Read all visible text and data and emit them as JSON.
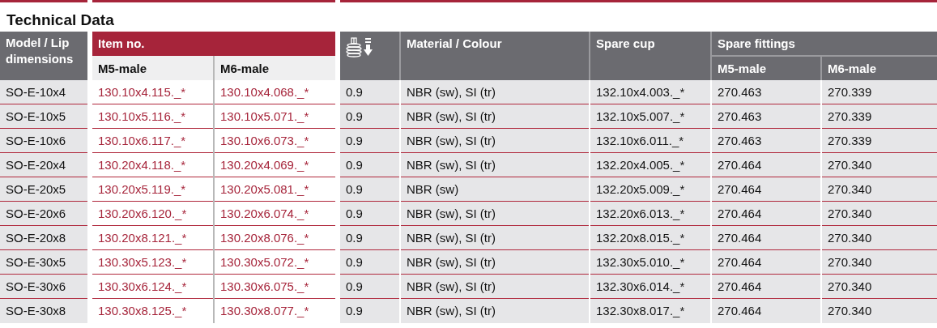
{
  "title": "Technical Data",
  "headers": {
    "model": "Model / Lip dimensions",
    "item_no": "Item no.",
    "item_m5": "M5-male",
    "item_m6": "M6-male",
    "material": "Material / Colour",
    "spare_cup": "Spare cup",
    "spare_fittings": "Spare fittings",
    "fit_m5": "M5-male",
    "fit_m6": "M6-male"
  },
  "rows": [
    {
      "model": "SO-E-10x4",
      "item_m5": "130.10x4.115._*",
      "item_m6": "130.10x4.068._*",
      "stroke": "0.9",
      "material": "NBR (sw), SI (tr)",
      "spare_cup": "132.10x4.003._*",
      "fit_m5": "270.463",
      "fit_m6": "270.339"
    },
    {
      "model": "SO-E-10x5",
      "item_m5": "130.10x5.116._*",
      "item_m6": "130.10x5.071._*",
      "stroke": "0.9",
      "material": "NBR (sw), SI (tr)",
      "spare_cup": "132.10x5.007._*",
      "fit_m5": "270.463",
      "fit_m6": "270.339"
    },
    {
      "model": "SO-E-10x6",
      "item_m5": "130.10x6.117._*",
      "item_m6": "130.10x6.073._*",
      "stroke": "0.9",
      "material": "NBR (sw), SI (tr)",
      "spare_cup": "132.10x6.011._*",
      "fit_m5": "270.463",
      "fit_m6": "270.339"
    },
    {
      "model": "SO-E-20x4",
      "item_m5": "130.20x4.118._*",
      "item_m6": "130.20x4.069._*",
      "stroke": "0.9",
      "material": "NBR (sw), SI (tr)",
      "spare_cup": "132.20x4.005._*",
      "fit_m5": "270.464",
      "fit_m6": "270.340"
    },
    {
      "model": "SO-E-20x5",
      "item_m5": "130.20x5.119._*",
      "item_m6": "130.20x5.081._*",
      "stroke": "0.9",
      "material": "NBR (sw)",
      "spare_cup": "132.20x5.009._*",
      "fit_m5": "270.464",
      "fit_m6": "270.340"
    },
    {
      "model": "SO-E-20x6",
      "item_m5": "130.20x6.120._*",
      "item_m6": "130.20x6.074._*",
      "stroke": "0.9",
      "material": "NBR (sw), SI (tr)",
      "spare_cup": "132.20x6.013._*",
      "fit_m5": "270.464",
      "fit_m6": "270.340"
    },
    {
      "model": "SO-E-20x8",
      "item_m5": "130.20x8.121._*",
      "item_m6": "130.20x8.076._*",
      "stroke": "0.9",
      "material": "NBR (sw), SI (tr)",
      "spare_cup": "132.20x8.015._*",
      "fit_m5": "270.464",
      "fit_m6": "270.340"
    },
    {
      "model": "SO-E-30x5",
      "item_m5": "130.30x5.123._*",
      "item_m6": "130.30x5.072._*",
      "stroke": "0.9",
      "material": "NBR (sw), SI (tr)",
      "spare_cup": "132.30x5.010._*",
      "fit_m5": "270.464",
      "fit_m6": "270.340"
    },
    {
      "model": "SO-E-30x6",
      "item_m5": "130.30x6.124._*",
      "item_m6": "130.30x6.075._*",
      "stroke": "0.9",
      "material": "NBR (sw), SI (tr)",
      "spare_cup": "132.30x6.014._*",
      "fit_m5": "270.464",
      "fit_m6": "270.340"
    },
    {
      "model": "SO-E-30x8",
      "item_m5": "130.30x8.125._*",
      "item_m6": "130.30x8.077._*",
      "stroke": "0.9",
      "material": "NBR (sw), SI (tr)",
      "spare_cup": "132.30x8.017._*",
      "fit_m5": "270.464",
      "fit_m6": "270.340"
    }
  ]
}
